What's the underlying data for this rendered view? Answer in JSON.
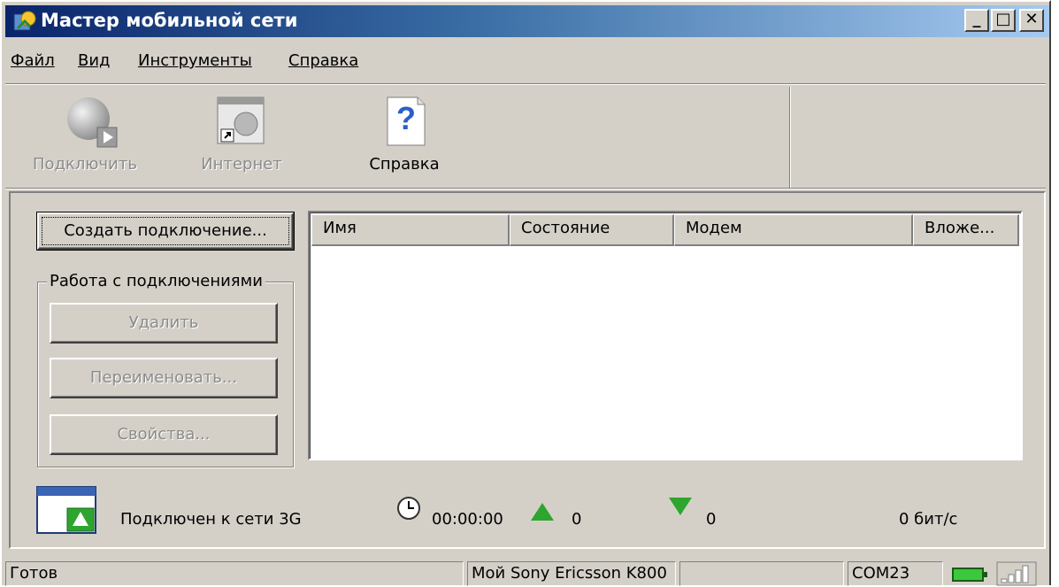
{
  "window": {
    "title": "Мастер мобильной сети",
    "controls": {
      "minimize": "_",
      "maximize": "□",
      "close": "✕"
    }
  },
  "menu": [
    {
      "label": "Файл"
    },
    {
      "label": "Вид"
    },
    {
      "label": "Инструменты"
    },
    {
      "label": "Справка"
    }
  ],
  "toolbar": {
    "connect": {
      "label": "Подключить",
      "enabled": false,
      "icon": "globe-play-icon"
    },
    "internet": {
      "label": "Интернет",
      "enabled": false,
      "icon": "internet-shortcut-icon"
    },
    "help": {
      "label": "Справка",
      "enabled": true,
      "icon": "help-question-icon"
    }
  },
  "actions": {
    "create_connection": "Создать подключение...",
    "group_title": "Работа с подключениями",
    "delete": "Удалить",
    "rename": "Переименовать...",
    "properties": "Свойства..."
  },
  "connections_list": {
    "columns": [
      "Имя",
      "Состояние",
      "Модем",
      "Вложе..."
    ],
    "rows": []
  },
  "connection_info": {
    "status_text": "Подключен к сети 3G",
    "duration": "00:00:00",
    "sent": "0",
    "received": "0",
    "speed": "0 бит/с"
  },
  "statusbar": {
    "state": "Готов",
    "device": "Мой Sony Ericsson K800",
    "empty_panel": "",
    "port": "COM23"
  },
  "colors": {
    "window_bg": "#d4d0c8",
    "title_start": "#0a246a",
    "title_end": "#a6caf0",
    "upload_arrow": "#2ea52e",
    "download_arrow": "#2ea52e",
    "battery": "#3cc83c"
  }
}
